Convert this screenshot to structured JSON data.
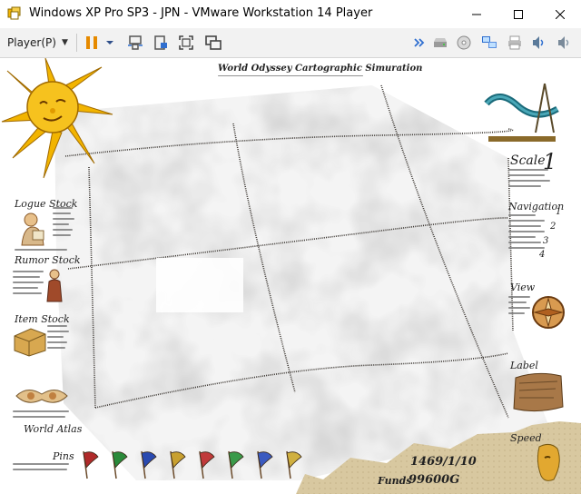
{
  "window": {
    "title": "Windows XP Pro SP3 - JPN - VMware Workstation 14 Player",
    "icon": "vmware-icon"
  },
  "toolbar": {
    "player_menu_label": "Player(P)",
    "icons": [
      "pause-icon",
      "send-ctrl-alt-del-icon",
      "suspend-icon",
      "fullscreen-icon",
      "unity-icon",
      "more-devices-icon",
      "hard-disk-icon",
      "cd-drive-icon",
      "network-icon",
      "printer-icon",
      "sound-icon",
      "audio-icon"
    ]
  },
  "game": {
    "title": "World Odyssey Cartographic Simuration",
    "left_panel": {
      "logue_stock": "Logue Stock",
      "rumor_stock": "Rumor Stock",
      "item_stock": "Item Stock",
      "world_atlas": "World Atlas",
      "pins": "Pins"
    },
    "right_panel": {
      "scale_label": "Scale",
      "scale_value": "1",
      "navigation": "Navigation",
      "nav_numbers": [
        "1",
        "2",
        "3",
        "4"
      ],
      "view": "View",
      "label": "Label",
      "speed": "Speed"
    },
    "status": {
      "date": "1469/1/10",
      "funds_label": "Funds",
      "funds_value": "99600G"
    },
    "pin_colors": [
      "#b02a2a",
      "#2a8a3a",
      "#2a4ab0",
      "#c8a030",
      "#c03a3a",
      "#3a9a4a",
      "#3a5ac0",
      "#d0b040"
    ],
    "colors": {
      "accent_blue": "#2f6fd0",
      "pause_orange": "#e68a00",
      "parchment": "#e8dcc0",
      "sun": "#f0a800"
    }
  }
}
